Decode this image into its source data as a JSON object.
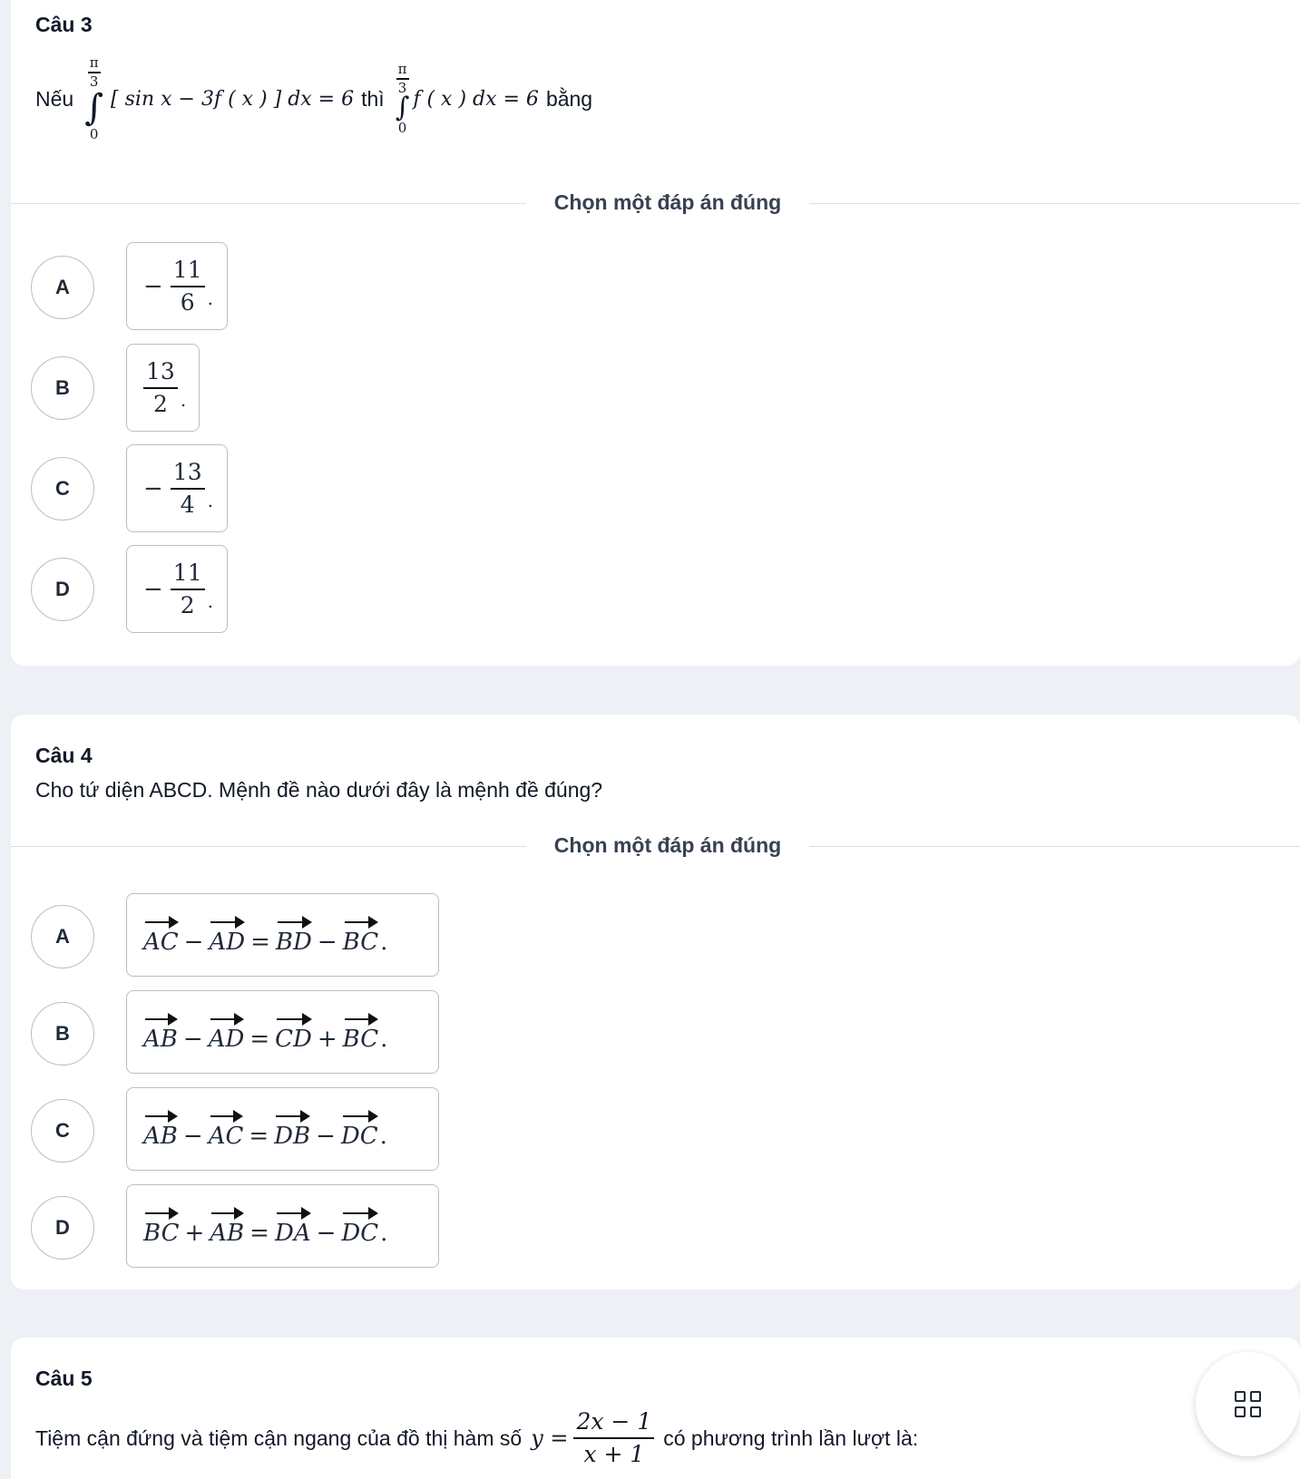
{
  "q3": {
    "title": "Câu 3",
    "prefix": "Nếu",
    "integrand": "[ sin x − 3f ( x ) ] dx = 6",
    "middle": "thì",
    "integrand2": "f ( x ) dx = 6",
    "suffix": "bằng",
    "upper_num": "π",
    "upper_den": "3",
    "lower": "0",
    "prompt": "Chọn một đáp án đúng",
    "options": [
      {
        "letter": "A",
        "sign": "−",
        "num": "11",
        "den": "6"
      },
      {
        "letter": "B",
        "sign": "",
        "num": "13",
        "den": "2"
      },
      {
        "letter": "C",
        "sign": "−",
        "num": "13",
        "den": "4"
      },
      {
        "letter": "D",
        "sign": "−",
        "num": "11",
        "den": "2"
      }
    ]
  },
  "q4": {
    "title": "Câu 4",
    "text": "Cho tứ diện ABCD. Mệnh đề nào dưới đây là mệnh đề đúng?",
    "prompt": "Chọn một đáp án đúng",
    "options": [
      {
        "letter": "A",
        "v1": "AC",
        "op1": "−",
        "v2": "AD",
        "op2": "=",
        "v3": "BD",
        "op3": "−",
        "v4": "BC"
      },
      {
        "letter": "B",
        "v1": "AB",
        "op1": "−",
        "v2": "AD",
        "op2": "=",
        "v3": "CD",
        "op3": "+",
        "v4": "BC"
      },
      {
        "letter": "C",
        "v1": "AB",
        "op1": "−",
        "v2": "AC",
        "op2": "=",
        "v3": "DB",
        "op3": "−",
        "v4": "DC"
      },
      {
        "letter": "D",
        "v1": "BC",
        "op1": "+",
        "v2": "AB",
        "op2": "=",
        "v3": "DA",
        "op3": "−",
        "v4": "DC"
      }
    ]
  },
  "q5": {
    "title": "Câu 5",
    "text_before": "Tiệm cận đứng và tiệm cận ngang của đồ thị hàm số",
    "y_eq": "y =",
    "num": "2x − 1",
    "den": "x + 1",
    "text_after": "có phương trình lần lượt là:"
  },
  "fab": {
    "icon": "grid-icon"
  }
}
